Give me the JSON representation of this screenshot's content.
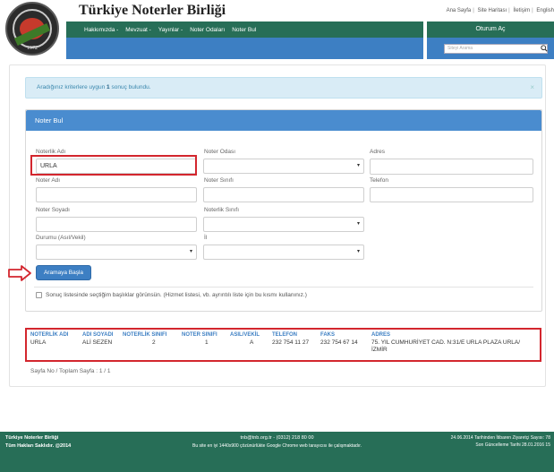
{
  "header": {
    "site_title": "Türkiye Noterler Birliği",
    "logo_year": "1972",
    "top_links": [
      "Ana Sayfa",
      "Site Haritası",
      "İletişim",
      "English"
    ],
    "nav": [
      "Hakkımızda -",
      "Mevzuat -",
      "Yayınlar -",
      "Noter Odaları",
      "Noter Bul"
    ],
    "login_label": "Oturum Aç",
    "search_placeholder": "Siteyi Arama"
  },
  "alert": {
    "prefix": "Aradığınız kriterlere uygun ",
    "count": "1",
    "suffix": " sonuç bulundu.",
    "close": "×"
  },
  "panel": {
    "title": "Noter Bul",
    "fields": {
      "noterlik_adi_label": "Noterlik Adı",
      "noterlik_adi_value": "URLA",
      "noter_odasi_label": "Noter Odası",
      "adres_label": "Adres",
      "noter_adi_label": "Noter Adı",
      "noter_sinifi_label": "Noter Sınıfı",
      "telefon_label": "Telefon",
      "noter_soyadi_label": "Noter Soyadı",
      "noterlik_sinifi_label": "Noterlik Sınıfı",
      "durumu_label": "Durumu (Asıl/Vekil)",
      "il_label": "İl"
    },
    "search_button": "Aramaya Başla",
    "checkbox_label": "Sonuç listesinde seçtiğim başlıklar görünsün. (Hizmet listesi, vb. ayrıntılı liste için bu kısmı kullanınız.)"
  },
  "results": {
    "headers": [
      "NOTERLİK ADI",
      "ADI SOYADI",
      "NOTERLİK SINIFI",
      "NOTER SINIFI",
      "ASIL/VEKİL",
      "TELEFON",
      "FAKS",
      "ADRES"
    ],
    "rows": [
      [
        "URLA",
        "ALİ SEZEN",
        "2",
        "1",
        "A",
        "232 754 11 27",
        "232 754 67 14",
        "75. YIL CUMHURİYET CAD. N:31/E URLA PLAZA URLA/İZMİR"
      ]
    ]
  },
  "pagination": "Sayfa No / Toplam Sayfa : 1 / 1",
  "footer": {
    "left_line1": "Türkiye Noterler Birliği",
    "left_line2": "Tüm Hakları Saklıdır. @2014",
    "center_line1": "tnb@tnb.org.tr - (0312) 218 80 00",
    "center_line2": "Bu site en iyi 1440x900 çözünürlükte Google Chrome web tarayıcısı ile çalışmaktadır.",
    "right_line1": "24.06.2014 Tarihinden İtibaren Ziyaretçi Sayısı: 78",
    "right_line2": "Son Güncelleme Tarihi 28.01.2016 15"
  },
  "colors": {
    "nav_green": "#276e57",
    "nav_blue": "#3d7fc3",
    "highlight_red": "#d3262e",
    "alert_bg": "#d9ecf6"
  }
}
